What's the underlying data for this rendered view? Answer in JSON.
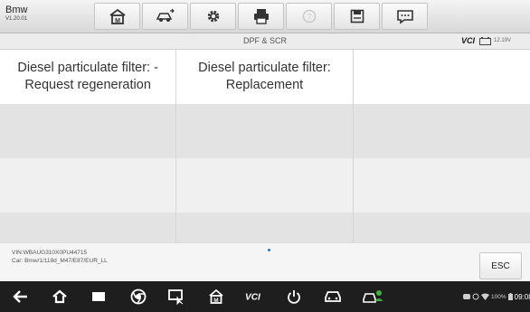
{
  "app": {
    "name": "Bmw",
    "version": "V1.20.01"
  },
  "toolbar": {
    "buttons": [
      "home-icon",
      "vehicle-swap-icon",
      "settings-icon",
      "print-icon",
      "help-icon",
      "save-icon",
      "chat-icon"
    ]
  },
  "subheader": {
    "title": "DPF & SCR",
    "vci_logo": "VCI",
    "battery_voltage": "12.19V"
  },
  "functions": {
    "rows": [
      [
        "Diesel particulate filter: - Request regeneration",
        "Diesel particulate filter: Replacement",
        ""
      ],
      [
        "",
        "",
        ""
      ],
      [
        "",
        "",
        ""
      ],
      [
        "",
        "",
        ""
      ]
    ]
  },
  "footer": {
    "vin": "VIN:WBAUG310X0PU44715",
    "car": "Car: Bmw/1/118d_M47/E87/EUR_LL",
    "esc_label": "ESC"
  },
  "statusbar": {
    "battery_percent": "100%",
    "time": "09:08"
  },
  "colors": {
    "toolbar_bg": "#e6e6e6",
    "navbar_bg": "#1e1e1e",
    "row_alt": "#e3e3e3",
    "accent_dot": "#2f6fd6"
  }
}
